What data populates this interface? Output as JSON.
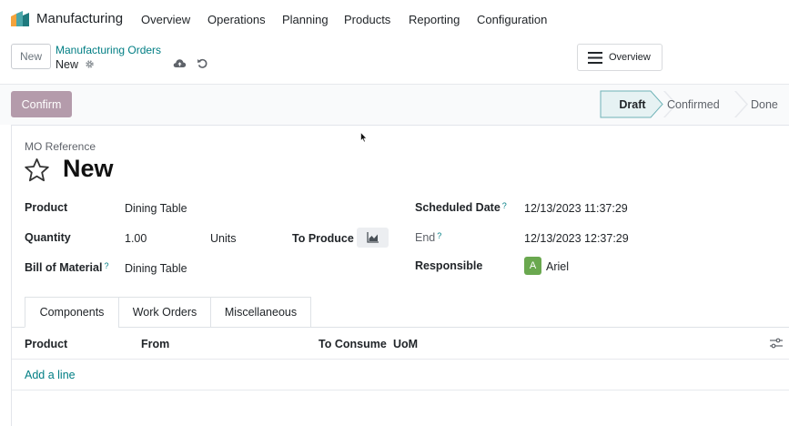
{
  "navbar": {
    "app_name": "Manufacturing",
    "menu": [
      "Overview",
      "Operations",
      "Planning",
      "Products",
      "Reporting",
      "Configuration"
    ]
  },
  "control_panel": {
    "new_button": "New",
    "breadcrumb": "Manufacturing Orders",
    "record_name": "New",
    "overview_button": "Overview"
  },
  "statusbar": {
    "confirm_button": "Confirm",
    "stages": [
      "Draft",
      "Confirmed",
      "Done"
    ],
    "active_stage": "Draft"
  },
  "form": {
    "reference_label": "MO Reference",
    "title": "New",
    "product_label": "Product",
    "product_value": "Dining Table",
    "quantity_label": "Quantity",
    "quantity_value": "1.00",
    "uom_value": "Units",
    "to_produce_label": "To Produce",
    "bom_label": "Bill of Material",
    "bom_value": "Dining Table",
    "scheduled_label": "Scheduled Date",
    "scheduled_value": "12/13/2023 11:37:29",
    "end_label": "End",
    "end_value": "12/13/2023 12:37:29",
    "responsible_label": "Responsible",
    "responsible_initial": "A",
    "responsible_name": "Ariel",
    "help_mark": "?"
  },
  "tabs": [
    "Components",
    "Work Orders",
    "Miscellaneous"
  ],
  "components_table": {
    "columns": [
      "Product",
      "From",
      "To Consume",
      "UoM"
    ],
    "add_line": "Add a line"
  },
  "colors": {
    "accent": "#017e84",
    "confirm_button": "#b49bab",
    "active_stage_bg": "#e6f2f3",
    "avatar": "#6aa84f"
  },
  "icons": [
    "app-logo-icon",
    "gear-icon",
    "cloud-upload-icon",
    "undo-icon",
    "hamburger-icon",
    "star-icon",
    "area-chart-icon",
    "column-options-icon"
  ]
}
